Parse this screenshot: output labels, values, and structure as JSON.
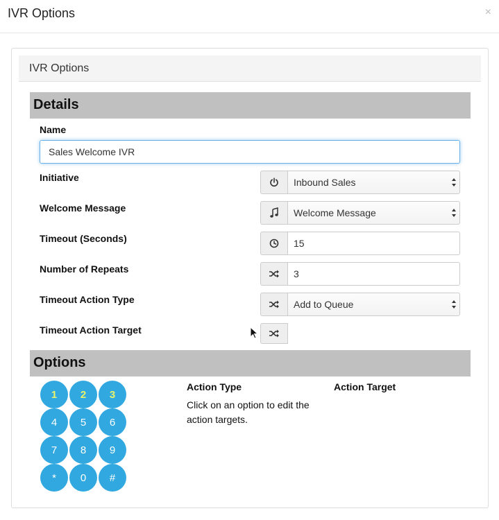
{
  "modal": {
    "title": "IVR Options",
    "close": "×"
  },
  "panel": {
    "title": "IVR Options"
  },
  "details": {
    "title": "Details",
    "name_label": "Name",
    "name_value": "Sales Welcome IVR",
    "initiative_label": "Initiative",
    "initiative_value": "Inbound Sales",
    "welcome_label": "Welcome Message",
    "welcome_value": "Welcome Message",
    "timeout_label": "Timeout (Seconds)",
    "timeout_value": "15",
    "repeats_label": "Number of Repeats",
    "repeats_value": "3",
    "action_type_label": "Timeout Action Type",
    "action_type_value": "Add to Queue",
    "action_target_label": "Timeout Action Target"
  },
  "options": {
    "title": "Options",
    "keys": [
      "1",
      "2",
      "3",
      "4",
      "5",
      "6",
      "7",
      "8",
      "9",
      "*",
      "0",
      "#"
    ],
    "highlighted_keys": [
      "1",
      "2",
      "3"
    ],
    "action_type_header": "Action Type",
    "action_target_header": "Action Target",
    "help_text": "Click on an option to edit the action targets."
  },
  "colors": {
    "key_blue": "#31a8e0",
    "key_highlight_text": "#e9f36b",
    "section_bar": "#c0c0c0",
    "input_focus": "#66afe9"
  },
  "icons": {
    "initiative": "power-icon",
    "welcome": "music-note-icon",
    "timeout": "clock-icon",
    "repeats": "shuffle-icon",
    "action_type": "shuffle-icon",
    "action_target": "shuffle-icon"
  }
}
